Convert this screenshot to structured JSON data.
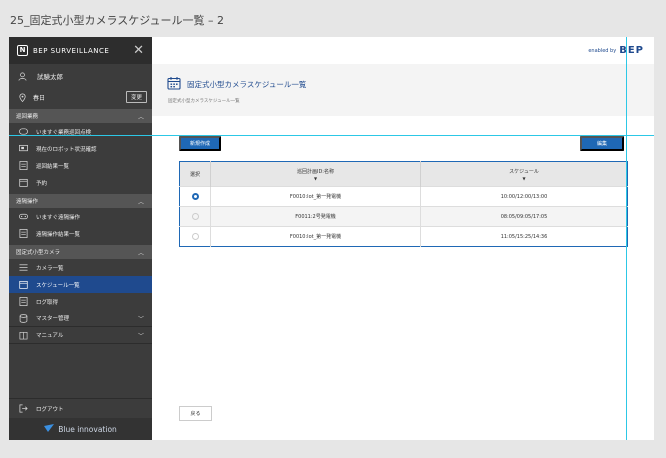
{
  "page_caption": "25_固定式小型カメラスケジュール一覧 – 2",
  "brand": {
    "mark": "N",
    "name": "BEP SURVEILLANCE"
  },
  "user": {
    "name": "試験太郎"
  },
  "location": {
    "name": "春日",
    "change_label": "変更"
  },
  "sections": [
    {
      "label": "巡回業務",
      "items": [
        {
          "label": "いますぐ業務巡回点検",
          "icon": "play-icon"
        },
        {
          "label": "現在のロボット状況確認",
          "icon": "monitor-icon"
        },
        {
          "label": "巡回結果一覧",
          "icon": "list-icon"
        },
        {
          "label": "予約",
          "icon": "calendar-icon"
        }
      ]
    },
    {
      "label": "遠隔操作",
      "items": [
        {
          "label": "いますぐ遠隔操作",
          "icon": "gamepad-icon"
        },
        {
          "label": "遠隔操作結果一覧",
          "icon": "list-icon"
        }
      ]
    },
    {
      "label": "固定式小型カメラ",
      "items": [
        {
          "label": "カメラ一覧",
          "icon": "menu-icon"
        },
        {
          "label": "スケジュール一覧",
          "icon": "calendar-icon",
          "active": true
        },
        {
          "label": "ログ取得",
          "icon": "list-icon"
        }
      ]
    }
  ],
  "collapsed": [
    {
      "label": "マスター管理",
      "icon": "database-icon"
    },
    {
      "label": "マニュアル",
      "icon": "book-icon"
    }
  ],
  "logout_label": "ログアウト",
  "footer_brand": "Blue innovation",
  "topbar": {
    "enabled_by": "enabled by",
    "logo": "BEP"
  },
  "title": "固定式小型カメラスケジュール一覧",
  "breadcrumb": "固定式小型カメラスケジュール一覧",
  "buttons": {
    "new": "新規作成",
    "edit": "編集",
    "back": "戻る"
  },
  "table": {
    "headers": [
      "選択",
      "巡回計画ID:名称",
      "スケジュール"
    ],
    "rows": [
      {
        "selected": true,
        "name": "F0010:lot_第一発電機",
        "schedule": "10:00/12:00/13:00"
      },
      {
        "selected": false,
        "name": "F0011:2号発電機",
        "schedule": "08:05/09:05/17:05"
      },
      {
        "selected": false,
        "name": "F0010:lot_第一発電機",
        "schedule": "11:05/15:25/14:36"
      }
    ]
  },
  "colors": {
    "accent": "#1f68b5",
    "active": "#1f4a8e",
    "sidebar": "#3c3c3c",
    "guide": "#2cc8e6"
  }
}
